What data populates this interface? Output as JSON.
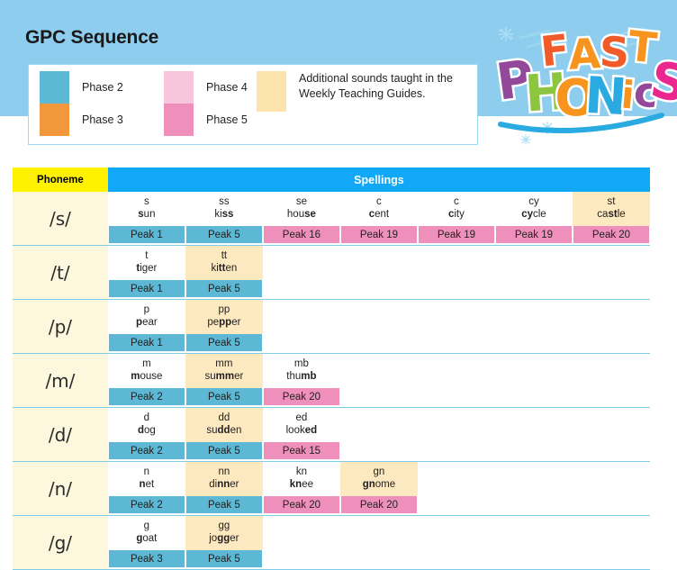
{
  "header": {
    "title": "GPC Sequence",
    "band_color": "#8ecdee"
  },
  "legend": {
    "items": [
      {
        "label": "Phase 2",
        "color": "#5cb8d4"
      },
      {
        "label": "Phase 3",
        "color": "#f1973c"
      },
      {
        "label": "Phase 4",
        "color": "#f7c6dd"
      },
      {
        "label": "Phase 5",
        "color": "#ef8fbb"
      }
    ],
    "note_color": "#fce2ab",
    "note": "Additional sounds taught in the Weekly Teaching Guides."
  },
  "logo": {
    "name": "fast-phonics-logo",
    "line1": "FAST",
    "line2": "PHONICS"
  },
  "table": {
    "headers": {
      "phoneme": "Phoneme",
      "spellings": "Spellings"
    },
    "column_count": 7,
    "rows": [
      {
        "phoneme": "/s/",
        "cells": [
          {
            "grapheme": "s",
            "word_pre": "",
            "word_bold": "s",
            "word_post": "un",
            "peak": "Peak 1",
            "peak_phase": "p2",
            "additional": false
          },
          {
            "grapheme": "ss",
            "word_pre": "ki",
            "word_bold": "ss",
            "word_post": "",
            "peak": "Peak 5",
            "peak_phase": "p2",
            "additional": false
          },
          {
            "grapheme": "se",
            "word_pre": "hou",
            "word_bold": "se",
            "word_post": "",
            "peak": "Peak 16",
            "peak_phase": "p5",
            "additional": false
          },
          {
            "grapheme": "c",
            "word_pre": "",
            "word_bold": "c",
            "word_post": "ent",
            "peak": "Peak 19",
            "peak_phase": "p5",
            "additional": false
          },
          {
            "grapheme": "c",
            "word_pre": "",
            "word_bold": "c",
            "word_post": "ity",
            "peak": "Peak 19",
            "peak_phase": "p5",
            "additional": false
          },
          {
            "grapheme": "cy",
            "word_pre": "",
            "word_bold": "cy",
            "word_post": "cle",
            "peak": "Peak 19",
            "peak_phase": "p5",
            "additional": false
          },
          {
            "grapheme": "st",
            "word_pre": "ca",
            "word_bold": "st",
            "word_post": "le",
            "peak": "Peak 20",
            "peak_phase": "p5",
            "additional": true
          }
        ]
      },
      {
        "phoneme": "/t/",
        "cells": [
          {
            "grapheme": "t",
            "word_pre": "",
            "word_bold": "t",
            "word_post": "iger",
            "peak": "Peak 1",
            "peak_phase": "p2",
            "additional": false
          },
          {
            "grapheme": "tt",
            "word_pre": "ki",
            "word_bold": "tt",
            "word_post": "en",
            "peak": "Peak 5",
            "peak_phase": "p2",
            "additional": true
          }
        ]
      },
      {
        "phoneme": "/p/",
        "cells": [
          {
            "grapheme": "p",
            "word_pre": "",
            "word_bold": "p",
            "word_post": "ear",
            "peak": "Peak 1",
            "peak_phase": "p2",
            "additional": false
          },
          {
            "grapheme": "pp",
            "word_pre": "pe",
            "word_bold": "pp",
            "word_post": "er",
            "peak": "Peak 5",
            "peak_phase": "p2",
            "additional": true
          }
        ]
      },
      {
        "phoneme": "/m/",
        "cells": [
          {
            "grapheme": "m",
            "word_pre": "",
            "word_bold": "m",
            "word_post": "ouse",
            "peak": "Peak 2",
            "peak_phase": "p2",
            "additional": false
          },
          {
            "grapheme": "mm",
            "word_pre": "su",
            "word_bold": "mm",
            "word_post": "er",
            "peak": "Peak 5",
            "peak_phase": "p2",
            "additional": true
          },
          {
            "grapheme": "mb",
            "word_pre": "thu",
            "word_bold": "mb",
            "word_post": "",
            "peak": "Peak 20",
            "peak_phase": "p5",
            "additional": false
          }
        ]
      },
      {
        "phoneme": "/d/",
        "cells": [
          {
            "grapheme": "d",
            "word_pre": "",
            "word_bold": "d",
            "word_post": "og",
            "peak": "Peak 2",
            "peak_phase": "p2",
            "additional": false
          },
          {
            "grapheme": "dd",
            "word_pre": "su",
            "word_bold": "dd",
            "word_post": "en",
            "peak": "Peak 5",
            "peak_phase": "p2",
            "additional": true
          },
          {
            "grapheme": "ed",
            "word_pre": "look",
            "word_bold": "ed",
            "word_post": "",
            "peak": "Peak 15",
            "peak_phase": "p5",
            "additional": false
          }
        ]
      },
      {
        "phoneme": "/n/",
        "cells": [
          {
            "grapheme": "n",
            "word_pre": "",
            "word_bold": "n",
            "word_post": "et",
            "peak": "Peak 2",
            "peak_phase": "p2",
            "additional": false
          },
          {
            "grapheme": "nn",
            "word_pre": "di",
            "word_bold": "nn",
            "word_post": "er",
            "peak": "Peak 5",
            "peak_phase": "p2",
            "additional": true
          },
          {
            "grapheme": "kn",
            "word_pre": "",
            "word_bold": "kn",
            "word_post": "ee",
            "peak": "Peak 20",
            "peak_phase": "p5",
            "additional": false
          },
          {
            "grapheme": "gn",
            "word_pre": "",
            "word_bold": "gn",
            "word_post": "ome",
            "peak": "Peak 20",
            "peak_phase": "p5",
            "additional": true
          }
        ]
      },
      {
        "phoneme": "/g/",
        "cells": [
          {
            "grapheme": "g",
            "word_pre": "",
            "word_bold": "g",
            "word_post": "oat",
            "peak": "Peak 3",
            "peak_phase": "p2",
            "additional": false
          },
          {
            "grapheme": "gg",
            "word_pre": "jo",
            "word_bold": "gg",
            "word_post": "er",
            "peak": "Peak 5",
            "peak_phase": "p2",
            "additional": true
          }
        ]
      }
    ]
  }
}
